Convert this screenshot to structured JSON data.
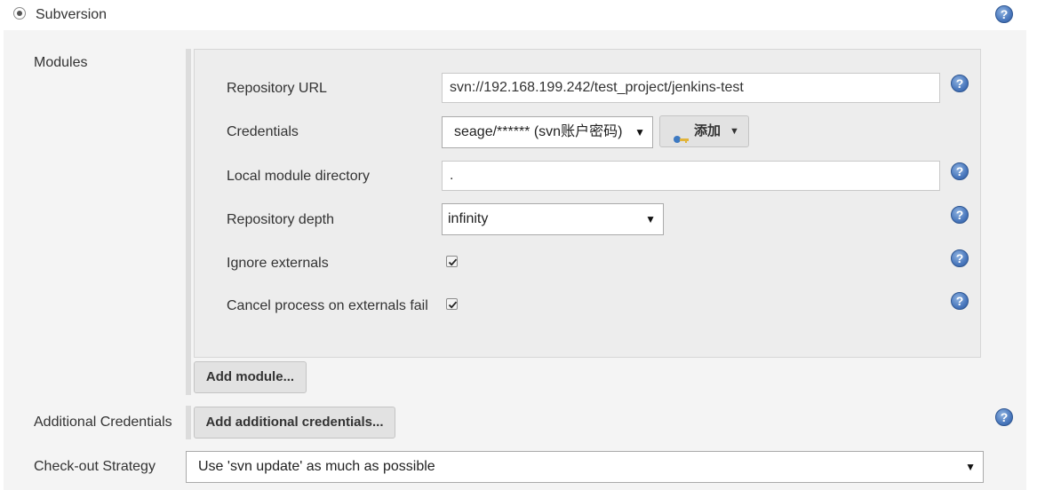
{
  "scm": {
    "label": "Subversion",
    "selected": true
  },
  "modules": {
    "section_label": "Modules",
    "repository_url": {
      "label": "Repository URL",
      "value": "svn://192.168.199.242/test_project/jenkins-test"
    },
    "credentials": {
      "label": "Credentials",
      "selected": "seage/****** (svn账户密码)",
      "add_label": "添加",
      "add_icon": "key-icon"
    },
    "local_module_directory": {
      "label": "Local module directory",
      "value": "."
    },
    "repository_depth": {
      "label": "Repository depth",
      "selected": "infinity"
    },
    "ignore_externals": {
      "label": "Ignore externals",
      "checked": true
    },
    "cancel_on_externals_fail": {
      "label": "Cancel process on externals fail",
      "checked": true
    },
    "add_module_label": "Add module..."
  },
  "additional_credentials": {
    "section_label": "Additional Credentials",
    "button_label": "Add additional credentials..."
  },
  "checkout_strategy": {
    "section_label": "Check-out Strategy",
    "selected": "Use 'svn update' as much as possible"
  },
  "help_icon": "help-icon",
  "colors": {
    "help_blue": "#4a78bd",
    "panel_bg": "#f4f4f4",
    "box_bg": "#ededed"
  }
}
